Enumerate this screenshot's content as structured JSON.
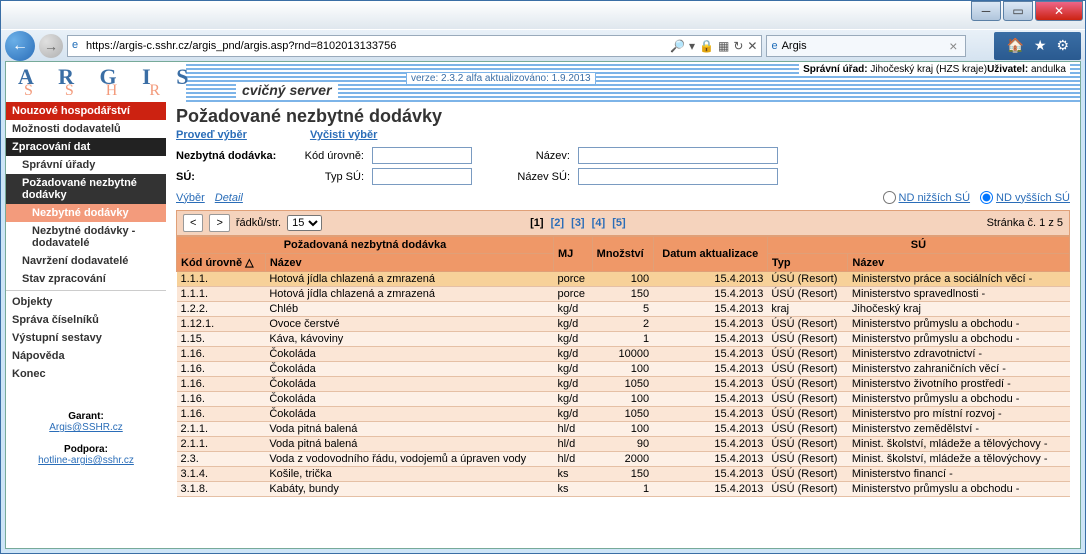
{
  "window": {
    "title": "Argis"
  },
  "browser": {
    "url": "https://argis-c.sshr.cz/argis_pnd/argis.asp?rnd=8102013133756",
    "tab_title": "Argis"
  },
  "header": {
    "logo1": "A R G I S",
    "logo2": "S S H R",
    "server": "cvičný server",
    "version": "verze: 2.3.2 alfa aktualizováno: 1.9.2013",
    "spravni_urad_label": "Správní úřad:",
    "spravni_urad": "Jihočeský kraj (HZS kraje)",
    "uzivatel_label": "Uživatel:",
    "uzivatel": "andulka"
  },
  "sidebar": {
    "sec_nouz": "Nouzové hospodářství",
    "moznosti": "Možnosti dodavatelů",
    "sec_zprac": "Zpracování dat",
    "spravni_urady": "Správní úřady",
    "pozadovane": "Požadované nezbytné dodávky",
    "nezbytne_dodavky": "Nezbytné dodávky",
    "nezbytne_dodavky_dod": "Nezbytné dodávky - dodavatelé",
    "navrzeni": "Navržení dodavatelé",
    "stav": "Stav zpracování",
    "objekty": "Objekty",
    "sprava_cis": "Správa číselníků",
    "vystupni": "Výstupní sestavy",
    "napoveda": "Nápověda",
    "konec": "Konec",
    "garant_label": "Garant:",
    "garant_mail": "Argis@SSHR.cz",
    "podpora_label": "Podpora:",
    "podpora_mail": "hotline-argis@sshr.cz"
  },
  "main": {
    "title": "Požadované nezbytné dodávky",
    "proved": "Proveď výběr",
    "vycisti": "Vyčisti výběr",
    "filter": {
      "nezbytna_label": "Nezbytná dodávka:",
      "kod_label": "Kód úrovně:",
      "nazev_label": "Název:",
      "su_label": "SÚ:",
      "typ_label": "Typ SÚ:",
      "nazev_su_label": "Název SÚ:"
    },
    "vyber": "Výběr",
    "detail": "Detail",
    "nd_nizsich": "ND nižších SÚ",
    "nd_vyssich": "ND vyšších SÚ",
    "rows_label": "řádků/str.",
    "rows_value": "15",
    "pages": [
      "[1]",
      "[2]",
      "[3]",
      "[4]",
      "[5]"
    ],
    "page_info": "Stránka č. 1 z 5",
    "thead": {
      "group_pnd": "Požadovaná nezbytná dodávka",
      "mnozstvi": "Množství",
      "datum": "Datum aktualizace",
      "group_su": "SÚ",
      "kod": "Kód úrovně △",
      "nazev": "Název",
      "mj": "MJ",
      "typ": "Typ",
      "nazev2": "Název"
    },
    "rows": [
      {
        "kod": "1.1.1.",
        "nazev": "Hotová jídla chlazená a zmrazená",
        "mj": "porce",
        "mnoz": "100",
        "datum": "15.4.2013",
        "typ": "ÚSÚ (Resort)",
        "sunazev": "Ministerstvo práce a sociálních věcí -"
      },
      {
        "kod": "1.1.1.",
        "nazev": "Hotová jídla chlazená a zmrazená",
        "mj": "porce",
        "mnoz": "150",
        "datum": "15.4.2013",
        "typ": "ÚSÚ (Resort)",
        "sunazev": "Ministerstvo spravedlnosti -"
      },
      {
        "kod": "1.2.2.",
        "nazev": "Chléb",
        "mj": "kg/d",
        "mnoz": "5",
        "datum": "15.4.2013",
        "typ": "kraj",
        "sunazev": "Jihočeský kraj"
      },
      {
        "kod": "1.12.1.",
        "nazev": "Ovoce čerstvé",
        "mj": "kg/d",
        "mnoz": "2",
        "datum": "15.4.2013",
        "typ": "ÚSÚ (Resort)",
        "sunazev": "Ministerstvo průmyslu a obchodu -"
      },
      {
        "kod": "1.15.",
        "nazev": "Káva, kávoviny",
        "mj": "kg/d",
        "mnoz": "1",
        "datum": "15.4.2013",
        "typ": "ÚSÚ (Resort)",
        "sunazev": "Ministerstvo průmyslu a obchodu -"
      },
      {
        "kod": "1.16.",
        "nazev": "Čokoláda",
        "mj": "kg/d",
        "mnoz": "10000",
        "datum": "15.4.2013",
        "typ": "ÚSÚ (Resort)",
        "sunazev": "Ministerstvo zdravotnictví -"
      },
      {
        "kod": "1.16.",
        "nazev": "Čokoláda",
        "mj": "kg/d",
        "mnoz": "100",
        "datum": "15.4.2013",
        "typ": "ÚSÚ (Resort)",
        "sunazev": "Ministerstvo zahraničních věcí -"
      },
      {
        "kod": "1.16.",
        "nazev": "Čokoláda",
        "mj": "kg/d",
        "mnoz": "1050",
        "datum": "15.4.2013",
        "typ": "ÚSÚ (Resort)",
        "sunazev": "Ministerstvo životního prostředí -"
      },
      {
        "kod": "1.16.",
        "nazev": "Čokoláda",
        "mj": "kg/d",
        "mnoz": "100",
        "datum": "15.4.2013",
        "typ": "ÚSÚ (Resort)",
        "sunazev": "Ministerstvo průmyslu a obchodu -"
      },
      {
        "kod": "1.16.",
        "nazev": "Čokoláda",
        "mj": "kg/d",
        "mnoz": "1050",
        "datum": "15.4.2013",
        "typ": "ÚSÚ (Resort)",
        "sunazev": "Ministerstvo pro místní rozvoj -"
      },
      {
        "kod": "2.1.1.",
        "nazev": "Voda pitná balená",
        "mj": "hl/d",
        "mnoz": "100",
        "datum": "15.4.2013",
        "typ": "ÚSÚ (Resort)",
        "sunazev": "Ministerstvo zemědělství -"
      },
      {
        "kod": "2.1.1.",
        "nazev": "Voda pitná balená",
        "mj": "hl/d",
        "mnoz": "90",
        "datum": "15.4.2013",
        "typ": "ÚSÚ (Resort)",
        "sunazev": "Minist. školství, mládeže a tělovýchovy -"
      },
      {
        "kod": "2.3.",
        "nazev": "Voda z vodovodního řádu, vodojemů a úpraven vody",
        "mj": "hl/d",
        "mnoz": "2000",
        "datum": "15.4.2013",
        "typ": "ÚSÚ (Resort)",
        "sunazev": "Minist. školství, mládeže a tělovýchovy -"
      },
      {
        "kod": "3.1.4.",
        "nazev": "Košile, trička",
        "mj": "ks",
        "mnoz": "150",
        "datum": "15.4.2013",
        "typ": "ÚSÚ (Resort)",
        "sunazev": "Ministerstvo financí -"
      },
      {
        "kod": "3.1.8.",
        "nazev": "Kabáty, bundy",
        "mj": "ks",
        "mnoz": "1",
        "datum": "15.4.2013",
        "typ": "ÚSÚ (Resort)",
        "sunazev": "Ministerstvo průmyslu a obchodu -"
      }
    ]
  }
}
